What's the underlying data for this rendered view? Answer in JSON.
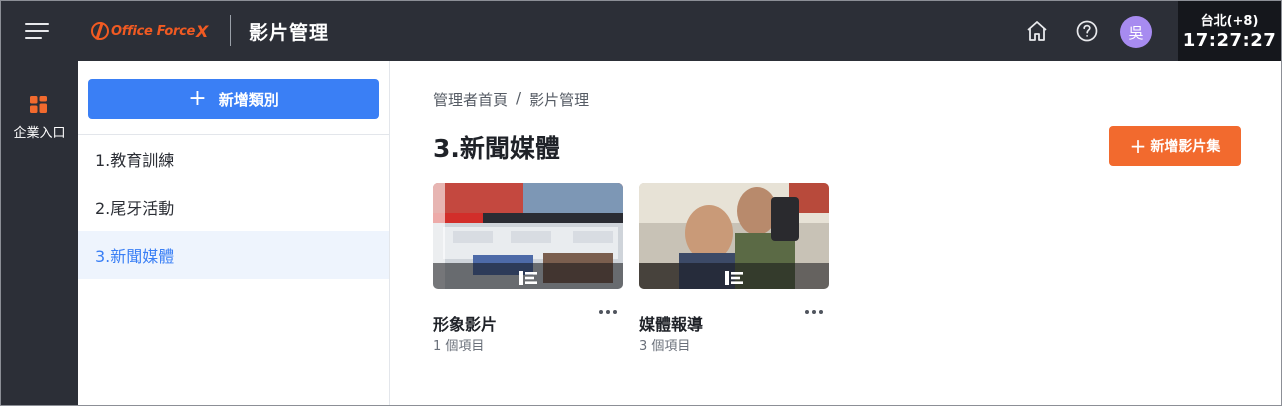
{
  "header": {
    "logo_text": "Office Force",
    "logo_x": "X",
    "app_title": "影片管理",
    "avatar_initial": "吳",
    "clock": {
      "city": "台北(+8)",
      "time": "17:27:27"
    }
  },
  "rail": {
    "items": [
      {
        "label": "企業入口"
      }
    ]
  },
  "categories": {
    "add_label": "新增類別",
    "items": [
      {
        "label": "1.教育訓練"
      },
      {
        "label": "2.尾牙活動"
      },
      {
        "label": "3.新聞媒體"
      }
    ],
    "active_index": 2
  },
  "main": {
    "breadcrumb": [
      "管理者首頁",
      "/",
      "影片管理"
    ],
    "title": "3.新聞媒體",
    "add_album_label": "新增影片集",
    "albums": [
      {
        "title": "形象影片",
        "count": "1 個項目"
      },
      {
        "title": "媒體報導",
        "count": "3 個項目"
      }
    ]
  },
  "colors": {
    "topbar": "#2c2f37",
    "primary": "#3a7ff5",
    "accent_orange": "#f26a2e",
    "brand_orange": "#f15a22",
    "avatar": "#a78bf0",
    "active_bg": "#eef4fd"
  },
  "icons": [
    "hamburger-icon",
    "home-icon",
    "help-icon",
    "grid-icon",
    "plus-icon",
    "more-icon"
  ]
}
